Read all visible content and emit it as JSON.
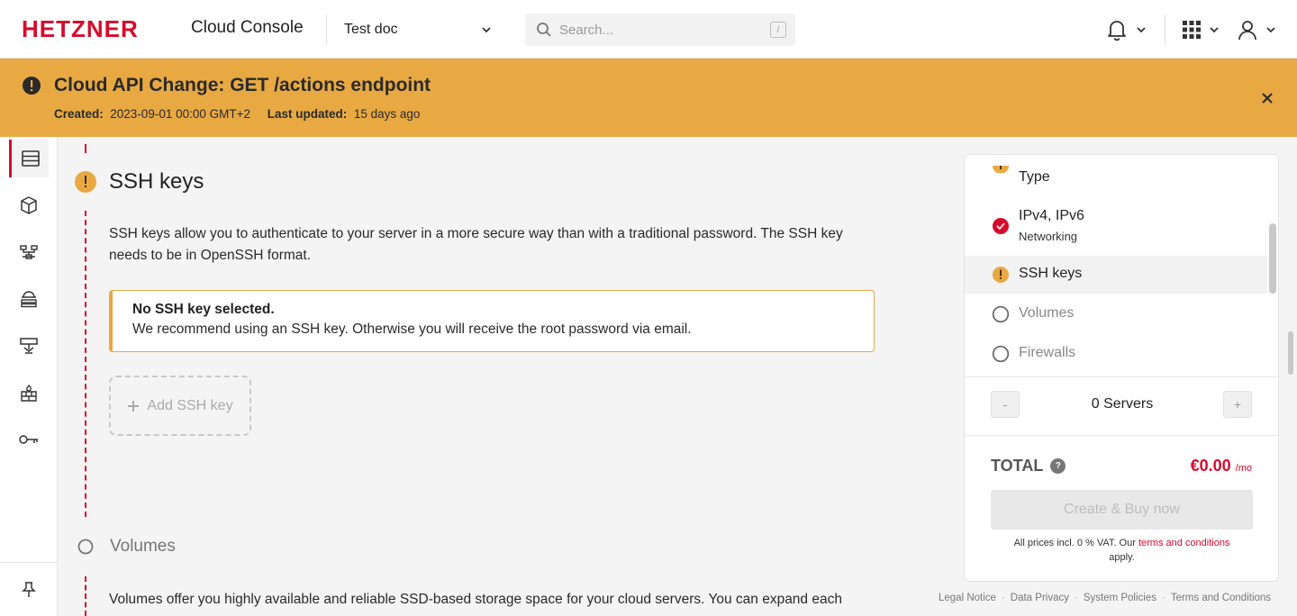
{
  "header": {
    "logo_text": "HETZNER",
    "app_title": "Cloud Console",
    "project": "Test doc",
    "search_placeholder": "Search...",
    "search_shortcut": "/"
  },
  "banner": {
    "title": "Cloud API Change: GET /actions endpoint",
    "created_label": "Created:",
    "created_value": "2023-09-01 00:00 GMT+2",
    "updated_label": "Last updated:",
    "updated_value": "15 days ago"
  },
  "sidebar": {
    "items": [
      {
        "icon": "servers-icon"
      },
      {
        "icon": "box-icon"
      },
      {
        "icon": "network-icon"
      },
      {
        "icon": "load-balancer-icon"
      },
      {
        "icon": "ip-icon"
      },
      {
        "icon": "firewall-icon"
      },
      {
        "icon": "key-icon"
      }
    ],
    "pin_icon": "pin-icon"
  },
  "main": {
    "ssh": {
      "title": "SSH keys",
      "description": "SSH keys allow you to authenticate to your server in a more secure way than with a traditional password. The SSH key needs to be in OpenSSH format.",
      "warning_title": "No SSH key selected.",
      "warning_text": "We recommend using an SSH key. Otherwise you will receive the root password via email.",
      "add_button": "Add SSH key"
    },
    "volumes": {
      "title": "Volumes",
      "description": "Volumes offer you highly available and reliable SSD-based storage space for your cloud servers. You can expand each"
    }
  },
  "panel": {
    "steps": [
      {
        "label": "Type",
        "status": "warning"
      },
      {
        "label": "IPv4, IPv6",
        "sub": "Networking",
        "status": "done"
      },
      {
        "label": "SSH keys",
        "status": "warning"
      },
      {
        "label": "Volumes",
        "status": "empty"
      },
      {
        "label": "Firewalls",
        "status": "empty"
      }
    ],
    "qty_minus": "-",
    "qty_plus": "+",
    "qty_label": "0 Servers",
    "total_label": "TOTAL",
    "help": "?",
    "price": "€0.00",
    "price_unit": "/mo",
    "buy_button": "Create & Buy now",
    "vat_prefix": "All prices incl. 0 % VAT. Our",
    "vat_link": "terms and conditions",
    "vat_suffix": "apply."
  },
  "footer": {
    "links": [
      "Legal Notice",
      "Data Privacy",
      "System Policies",
      "Terms and Conditions"
    ],
    "separator": "·"
  },
  "colors": {
    "brand_red": "#d50c2d",
    "warning_orange": "#e8a943",
    "banner_bg": "#e8a943"
  }
}
